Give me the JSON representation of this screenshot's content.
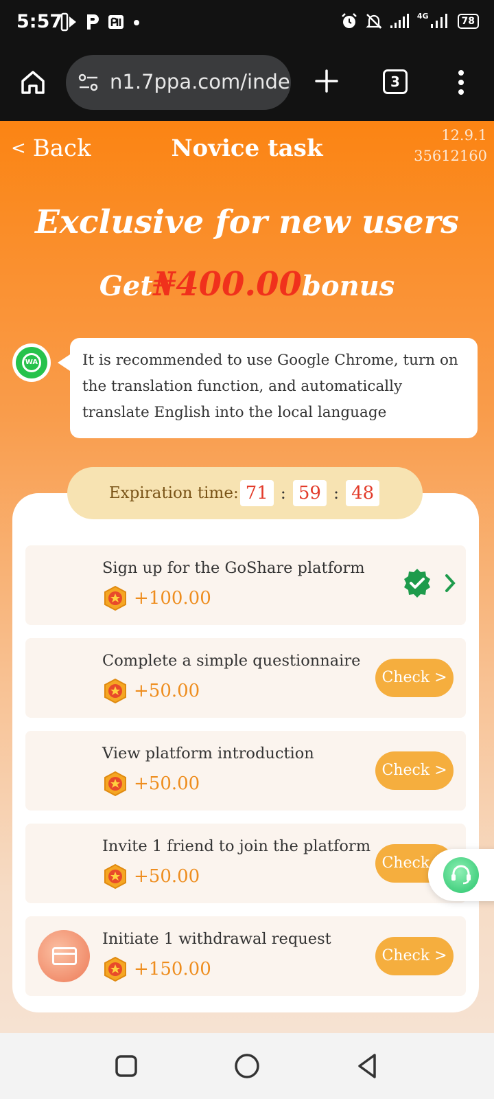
{
  "status_bar": {
    "time": "5:57",
    "battery": "78",
    "network": "4G"
  },
  "browser": {
    "url": "n1.7ppa.com/inde",
    "tab_count": "3"
  },
  "nav": {
    "back_label": "Back",
    "title": "Novice task",
    "version": "12.9.1",
    "user_id": "35612160"
  },
  "hero": {
    "title": "Exclusive for new users",
    "prefix": "Get",
    "amount": "₦400.00",
    "suffix": "bonus"
  },
  "tip": {
    "icon_label": "WA",
    "text": "It is recommended to use Google Chrome, turn on the translation function, and automatically translate English into the local language"
  },
  "expiry": {
    "label": "Expiration time:",
    "hours": "71",
    "minutes": "59",
    "seconds": "48"
  },
  "tasks": [
    {
      "label": "Sign up for the GoShare platform",
      "reward": "+100.00",
      "status": "completed"
    },
    {
      "label": "Complete a simple questionnaire",
      "reward": "+50.00",
      "button": "Check >"
    },
    {
      "label": "View platform introduction",
      "reward": "+50.00",
      "button": "Check >"
    },
    {
      "label": "Invite 1 friend to join the platform",
      "reward": "+50.00",
      "button": "Check >"
    },
    {
      "label": "Initiate 1 withdrawal request",
      "reward": "+150.00",
      "button": "Check >",
      "icon": "wallet-icon"
    }
  ],
  "colors": {
    "primary_orange": "#fb8413",
    "button_orange": "#f5ae3e",
    "amount_red": "#f0311c",
    "reward_orange": "#ee8d1e",
    "success_green": "#1e9b4c"
  }
}
